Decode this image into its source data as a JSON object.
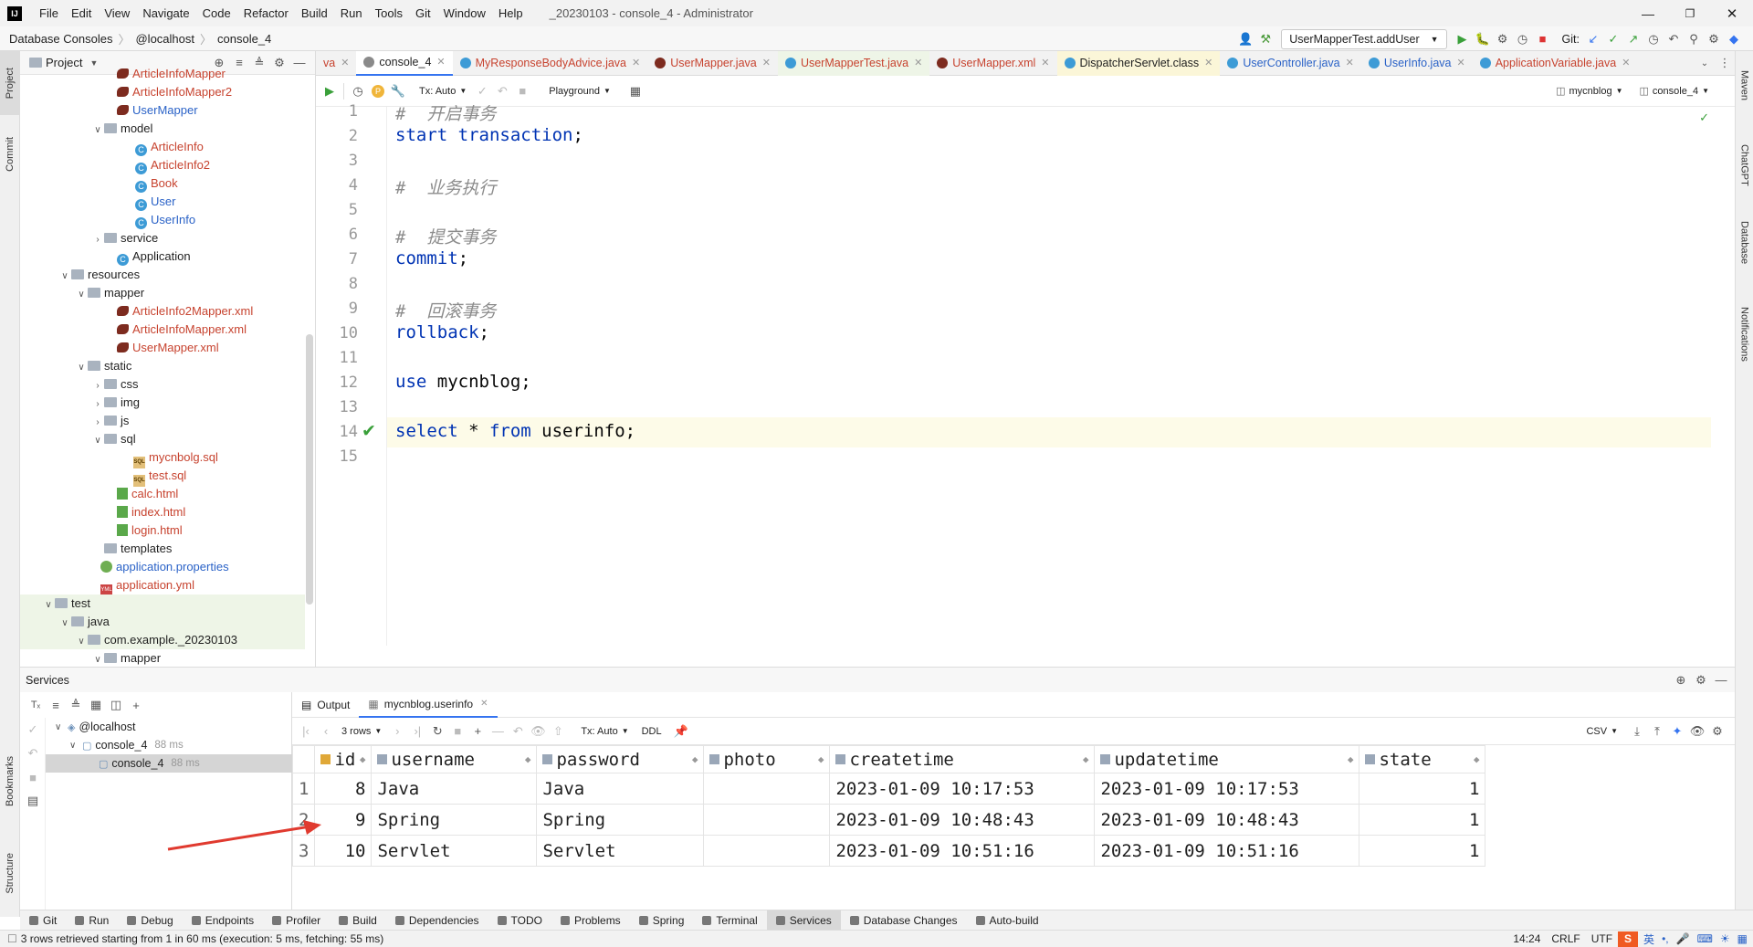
{
  "titlebar": {
    "menu": [
      "File",
      "Edit",
      "View",
      "Navigate",
      "Code",
      "Refactor",
      "Build",
      "Run",
      "Tools",
      "Git",
      "Window",
      "Help"
    ],
    "title": "_20230103 - console_4 - Administrator",
    "run_config": "UserMapperTest.addUser",
    "git_label": "Git:"
  },
  "breadcrumb": [
    "Database Consoles",
    "@localhost",
    "console_4"
  ],
  "left_strip": {
    "project": "Project",
    "commit": "Commit",
    "bookmarks": "Bookmarks",
    "structure": "Structure"
  },
  "right_strip": {
    "maven": "Maven",
    "chatgpt": "ChatGPT",
    "database": "Database",
    "notifications": "Notifications"
  },
  "project_panel": {
    "title": "Project",
    "tree": [
      {
        "label": "ArticleInfoMapper",
        "kind": "mybatis",
        "color": "red"
      },
      {
        "label": "ArticleInfoMapper2",
        "kind": "mybatis",
        "color": "red"
      },
      {
        "label": "UserMapper",
        "kind": "mybatis",
        "color": "blue"
      },
      {
        "label": "model",
        "kind": "folder",
        "color": "normal"
      },
      {
        "label": "ArticleInfo",
        "kind": "class",
        "color": "red"
      },
      {
        "label": "ArticleInfo2",
        "kind": "class",
        "color": "red"
      },
      {
        "label": "Book",
        "kind": "class",
        "color": "red"
      },
      {
        "label": "User",
        "kind": "class",
        "color": "blue"
      },
      {
        "label": "UserInfo",
        "kind": "class",
        "color": "blue"
      },
      {
        "label": "service",
        "kind": "folder",
        "color": "normal"
      },
      {
        "label": "Application",
        "kind": "class",
        "color": "normal"
      },
      {
        "label": "resources",
        "kind": "folder",
        "color": "normal"
      },
      {
        "label": "mapper",
        "kind": "folder",
        "color": "normal"
      },
      {
        "label": "ArticleInfo2Mapper.xml",
        "kind": "mybatis",
        "color": "red"
      },
      {
        "label": "ArticleInfoMapper.xml",
        "kind": "mybatis",
        "color": "red"
      },
      {
        "label": "UserMapper.xml",
        "kind": "mybatis",
        "color": "red"
      },
      {
        "label": "static",
        "kind": "folder",
        "color": "normal"
      },
      {
        "label": "css",
        "kind": "folder",
        "color": "normal"
      },
      {
        "label": "img",
        "kind": "folder",
        "color": "normal"
      },
      {
        "label": "js",
        "kind": "folder",
        "color": "normal"
      },
      {
        "label": "sql",
        "kind": "folder",
        "color": "normal"
      },
      {
        "label": "mycnbolg.sql",
        "kind": "sql",
        "color": "red"
      },
      {
        "label": "test.sql",
        "kind": "sql",
        "color": "red"
      },
      {
        "label": "calc.html",
        "kind": "html",
        "color": "red"
      },
      {
        "label": "index.html",
        "kind": "html",
        "color": "red"
      },
      {
        "label": "login.html",
        "kind": "html",
        "color": "red"
      },
      {
        "label": "templates",
        "kind": "folder",
        "color": "normal"
      },
      {
        "label": "application.properties",
        "kind": "properties",
        "color": "blue"
      },
      {
        "label": "application.yml",
        "kind": "yml",
        "color": "red"
      },
      {
        "label": "test",
        "kind": "folder",
        "color": "normal"
      },
      {
        "label": "java",
        "kind": "folder",
        "color": "normal"
      },
      {
        "label": "com.example._20230103",
        "kind": "folder",
        "color": "normal"
      },
      {
        "label": "mapper",
        "kind": "folder",
        "color": "normal"
      }
    ]
  },
  "editor_tabs": [
    {
      "label": "va",
      "active": false
    },
    {
      "label": "console_4",
      "active": true
    },
    {
      "label": "MyResponseBodyAdvice.java",
      "active": false
    },
    {
      "label": "UserMapper.java",
      "active": false
    },
    {
      "label": "UserMapperTest.java",
      "active": false
    },
    {
      "label": "UserMapper.xml",
      "active": false
    },
    {
      "label": "DispatcherServlet.class",
      "active": false
    },
    {
      "label": "UserController.java",
      "active": false
    },
    {
      "label": "UserInfo.java",
      "active": false
    },
    {
      "label": "ApplicationVariable.java",
      "active": false
    }
  ],
  "editor_toolbar": {
    "tx": "Tx: Auto",
    "playground": "Playground",
    "schema": "mycnblog",
    "console": "console_4"
  },
  "code_lines": [
    {
      "n": "1",
      "segments": [
        {
          "t": "#  开启事务",
          "c": "cm"
        }
      ]
    },
    {
      "n": "2",
      "segments": [
        {
          "t": "start transaction",
          "c": "kw"
        },
        {
          "t": ";",
          "c": "id"
        }
      ]
    },
    {
      "n": "3",
      "segments": []
    },
    {
      "n": "4",
      "segments": [
        {
          "t": "#  业务执行",
          "c": "cm"
        }
      ]
    },
    {
      "n": "5",
      "segments": []
    },
    {
      "n": "6",
      "segments": [
        {
          "t": "#  提交事务",
          "c": "cm"
        }
      ]
    },
    {
      "n": "7",
      "segments": [
        {
          "t": "commit",
          "c": "kw"
        },
        {
          "t": ";",
          "c": "id"
        }
      ]
    },
    {
      "n": "8",
      "segments": []
    },
    {
      "n": "9",
      "segments": [
        {
          "t": "#  回滚事务",
          "c": "cm"
        }
      ]
    },
    {
      "n": "10",
      "segments": [
        {
          "t": "rollback",
          "c": "kw"
        },
        {
          "t": ";",
          "c": "id"
        }
      ]
    },
    {
      "n": "11",
      "segments": []
    },
    {
      "n": "12",
      "segments": [
        {
          "t": "use ",
          "c": "kw"
        },
        {
          "t": "mycnblog;",
          "c": "id"
        }
      ]
    },
    {
      "n": "13",
      "segments": []
    },
    {
      "n": "14",
      "segments": [
        {
          "t": "select",
          "c": "kw"
        },
        {
          "t": " * ",
          "c": "id"
        },
        {
          "t": "from",
          "c": "kw"
        },
        {
          "t": " userinfo;",
          "c": "id"
        }
      ]
    },
    {
      "n": "15",
      "segments": []
    }
  ],
  "services": {
    "title": "Services",
    "tree": [
      {
        "label": "@localhost",
        "time": ""
      },
      {
        "label": "console_4",
        "time": "88 ms"
      },
      {
        "label": "console_4",
        "time": "88 ms"
      }
    ],
    "tabs": [
      "Output",
      "mycnblog.userinfo"
    ],
    "toolbar": {
      "rows": "3 rows",
      "tx": "Tx: Auto",
      "ddl": "DDL",
      "csv": "CSV"
    }
  },
  "result_table": {
    "columns": [
      "id",
      "username",
      "password",
      "photo",
      "createtime",
      "updatetime",
      "state"
    ],
    "rows": [
      [
        "1",
        "8",
        "Java",
        "Java",
        "",
        "2023-01-09 10:17:53",
        "2023-01-09 10:17:53",
        "1"
      ],
      [
        "2",
        "9",
        "Spring",
        "Spring",
        "",
        "2023-01-09 10:48:43",
        "2023-01-09 10:48:43",
        "1"
      ],
      [
        "3",
        "10",
        "Servlet",
        "Servlet",
        "",
        "2023-01-09 10:51:16",
        "2023-01-09 10:51:16",
        "1"
      ]
    ]
  },
  "bottom_tools": [
    "Git",
    "Run",
    "Debug",
    "Endpoints",
    "Profiler",
    "Build",
    "Dependencies",
    "TODO",
    "Problems",
    "Spring",
    "Terminal",
    "Services",
    "Database Changes",
    "Auto-build"
  ],
  "status": {
    "message": "3 rows retrieved starting from 1 in 60 ms (execution: 5 ms, fetching: 55 ms)",
    "time": "14:24",
    "line_sep": "CRLF",
    "encoding": "UTF",
    "ime": "英"
  },
  "colors": {
    "accent": "#3574f0",
    "arrow": "#e03a2f",
    "keyword": "#0033b3",
    "comment": "#8c8c8c"
  }
}
